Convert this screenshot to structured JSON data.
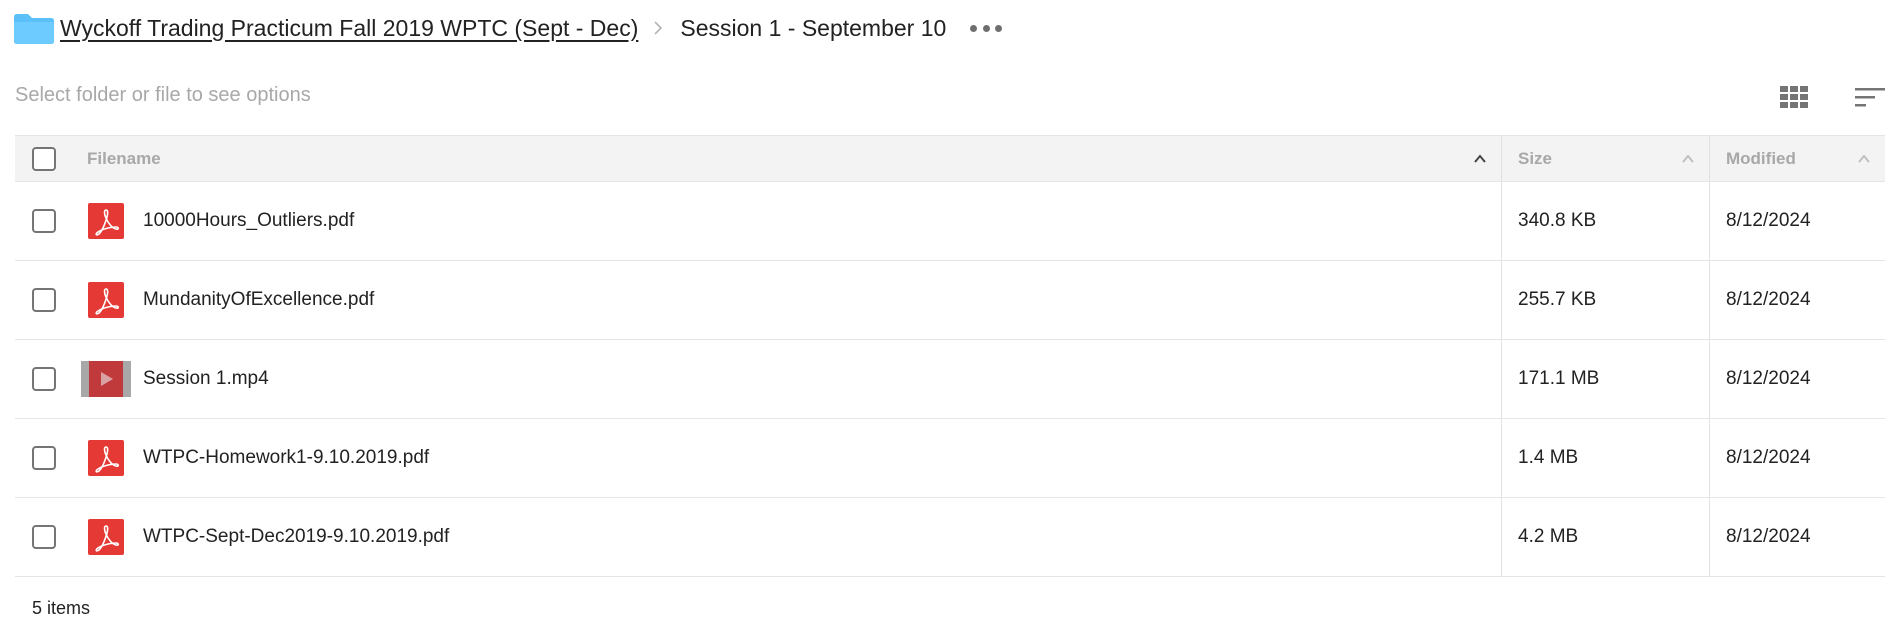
{
  "breadcrumb": {
    "folder_label": "Wyckoff Trading Practicum Fall 2019 WPTC (Sept - Dec)",
    "current_label": "Session 1 - September 10"
  },
  "hint_text": "Select folder or file to see options",
  "table": {
    "columns": {
      "filename": "Filename",
      "size": "Size",
      "modified": "Modified"
    },
    "rows": [
      {
        "name": "10000Hours_Outliers.pdf",
        "size": "340.8 KB",
        "modified": "8/12/2024",
        "icon": "pdf-icon"
      },
      {
        "name": "MundanityOfExcellence.pdf",
        "size": "255.7 KB",
        "modified": "8/12/2024",
        "icon": "pdf-icon"
      },
      {
        "name": "Session 1.mp4",
        "size": "171.1 MB",
        "modified": "8/12/2024",
        "icon": "video-icon"
      },
      {
        "name": "WTPC-Homework1-9.10.2019.pdf",
        "size": "1.4 MB",
        "modified": "8/12/2024",
        "icon": "pdf-icon"
      },
      {
        "name": "WTPC-Sept-Dec2019-9.10.2019.pdf",
        "size": "4.2 MB",
        "modified": "8/12/2024",
        "icon": "pdf-icon"
      }
    ]
  },
  "footer": {
    "item_count": "5 items"
  },
  "colors": {
    "folder": "#5bc0f8",
    "pdf": "#e53935",
    "video": "#c0393b",
    "header_bg": "#f3f3f3",
    "muted_text": "#a8a8a8"
  }
}
